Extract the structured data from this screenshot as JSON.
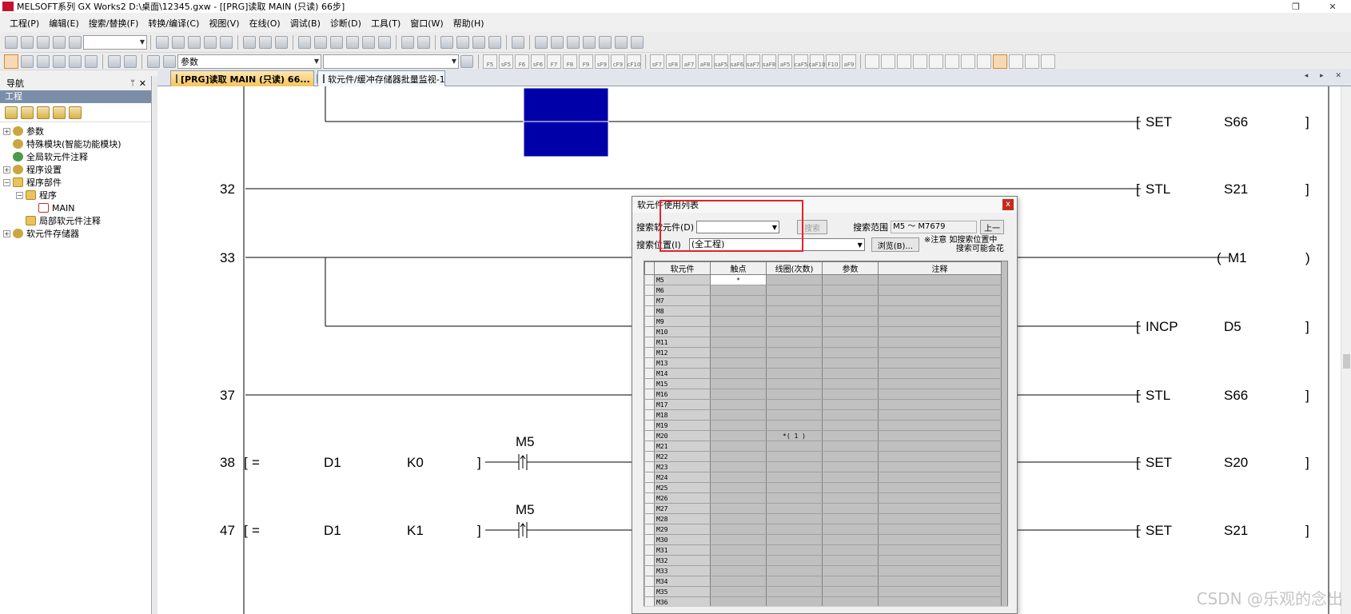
{
  "window": {
    "app_icon": "MELSOFT",
    "title": "MELSOFT系列 GX Works2 D:\\桌面\\12345.gxw - [[PRG]读取 MAIN (只读) 66步]",
    "restore_glyph": "❐",
    "close_glyph": "✕"
  },
  "menu": [
    "工程(P)",
    "编辑(E)",
    "搜索/替换(F)",
    "转换/编译(C)",
    "视图(V)",
    "在线(O)",
    "调试(B)",
    "诊断(D)",
    "工具(T)",
    "窗口(W)",
    "帮助(H)"
  ],
  "toolbar2": {
    "combo_value": "参数"
  },
  "nav": {
    "header": "导航",
    "pin_glyph": "ᛘ",
    "close_glyph": "✕",
    "section": "工程",
    "tree": [
      {
        "label": "参数",
        "expander": "+",
        "icon": "gear-icon"
      },
      {
        "label": "特殊模块(智能功能模块)",
        "expander": "",
        "icon": "gear-icon"
      },
      {
        "label": "全局软元件注释",
        "expander": "",
        "icon": "globe-icon"
      },
      {
        "label": "程序设置",
        "expander": "+",
        "icon": "gear-icon"
      },
      {
        "label": "程序部件",
        "expander": "−",
        "icon": "folder-icon"
      },
      {
        "label": "程序",
        "expander": "−",
        "icon": "folder-icon"
      },
      {
        "label": "MAIN",
        "expander": "",
        "icon": "program-icon"
      },
      {
        "label": "局部软元件注释",
        "expander": "",
        "icon": "folder-icon"
      },
      {
        "label": "软元件存储器",
        "expander": "+",
        "icon": "gear-icon"
      }
    ]
  },
  "tabs": [
    {
      "label": "[PRG]读取 MAIN (只读) 66...",
      "close": "✕"
    },
    {
      "label": "软元件/缓冲存储器批量监视-1"
    }
  ],
  "tab_arrows": "◂ ▸ ✕",
  "ladder": {
    "step_numbers": [
      "32",
      "33",
      "37",
      "38",
      "47"
    ],
    "instructions": [
      {
        "op": "SET",
        "arg": "S66"
      },
      {
        "op": "STL",
        "arg": "S21"
      },
      {
        "op": "M1"
      },
      {
        "op": "INCP",
        "arg": "D5"
      },
      {
        "op": "STL",
        "arg": "S66"
      },
      {
        "op": "SET",
        "arg": "S20"
      },
      {
        "op": "SET",
        "arg": "S21"
      }
    ],
    "compare_rows": [
      {
        "op": "=",
        "a": "D1",
        "b": "K0",
        "contact": "M5"
      },
      {
        "op": "=",
        "a": "D1",
        "b": "K1",
        "contact": "M5"
      }
    ],
    "bracket_open": "[",
    "bracket_close": "]",
    "coil_open": "(",
    "coil_close": ")"
  },
  "dialog": {
    "title": "软元件使用列表",
    "close_glyph": "x",
    "search_device_label": "搜索软元件(D)",
    "search_device_value": "",
    "search_button": "搜索",
    "search_range_label": "搜索范围",
    "search_range_value": "M5 ～ M7679",
    "prev_button": "上一",
    "search_location_label": "搜索位置(I)",
    "search_location_value": "(全工程)",
    "browse_button": "浏览(B)...",
    "note_line1": "※注意  如搜索位置中",
    "note_line2": "搜索可能会花",
    "columns": [
      "软元件",
      "触点",
      "线圈(次数)",
      "参数",
      "注释"
    ],
    "rows": [
      {
        "device": "M5",
        "contact": "*",
        "coil": ""
      },
      {
        "device": "M6",
        "contact": "",
        "coil": ""
      },
      {
        "device": "M7",
        "contact": "",
        "coil": ""
      },
      {
        "device": "M8",
        "contact": "",
        "coil": ""
      },
      {
        "device": "M9",
        "contact": "",
        "coil": ""
      },
      {
        "device": "M10",
        "contact": "",
        "coil": ""
      },
      {
        "device": "M11",
        "contact": "",
        "coil": ""
      },
      {
        "device": "M12",
        "contact": "",
        "coil": ""
      },
      {
        "device": "M13",
        "contact": "",
        "coil": ""
      },
      {
        "device": "M14",
        "contact": "",
        "coil": ""
      },
      {
        "device": "M15",
        "contact": "",
        "coil": ""
      },
      {
        "device": "M16",
        "contact": "",
        "coil": ""
      },
      {
        "device": "M17",
        "contact": "",
        "coil": ""
      },
      {
        "device": "M18",
        "contact": "",
        "coil": ""
      },
      {
        "device": "M19",
        "contact": "",
        "coil": ""
      },
      {
        "device": "M20",
        "contact": "",
        "coil": "*(  1  )"
      },
      {
        "device": "M21",
        "contact": "",
        "coil": ""
      },
      {
        "device": "M22",
        "contact": "",
        "coil": ""
      },
      {
        "device": "M23",
        "contact": "",
        "coil": ""
      },
      {
        "device": "M24",
        "contact": "",
        "coil": ""
      },
      {
        "device": "M25",
        "contact": "",
        "coil": ""
      },
      {
        "device": "M26",
        "contact": "",
        "coil": ""
      },
      {
        "device": "M27",
        "contact": "",
        "coil": ""
      },
      {
        "device": "M28",
        "contact": "",
        "coil": ""
      },
      {
        "device": "M29",
        "contact": "",
        "coil": ""
      },
      {
        "device": "M30",
        "contact": "",
        "coil": ""
      },
      {
        "device": "M31",
        "contact": "",
        "coil": ""
      },
      {
        "device": "M32",
        "contact": "",
        "coil": ""
      },
      {
        "device": "M33",
        "contact": "",
        "coil": ""
      },
      {
        "device": "M34",
        "contact": "",
        "coil": ""
      },
      {
        "device": "M35",
        "contact": "",
        "coil": ""
      },
      {
        "device": "M36",
        "contact": "",
        "coil": ""
      }
    ]
  },
  "watermark": "CSDN @乐观的念出",
  "colors": {
    "selection": "#0000a8",
    "highlight": "#e8202a",
    "grid_bg": "#c0c0c0"
  }
}
